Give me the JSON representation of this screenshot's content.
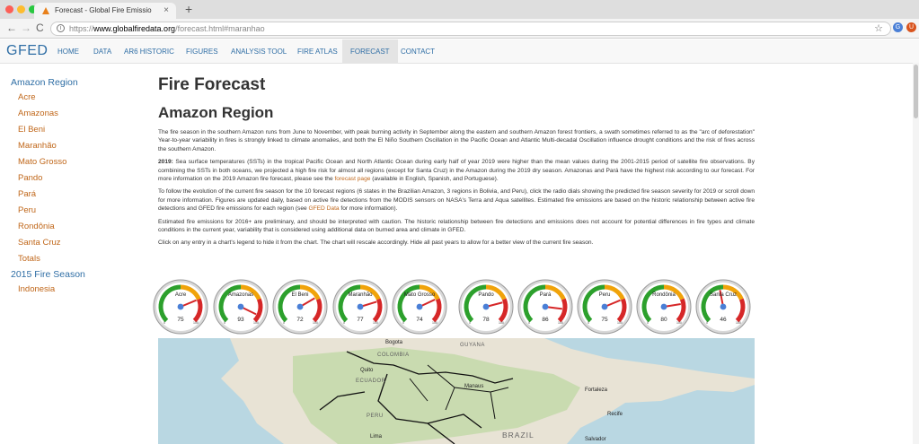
{
  "browser": {
    "tab_title": "Forecast - Global Fire Emissio",
    "url_scheme": "https://",
    "url_host": "www.globalfiredata.org",
    "url_path": "/forecast.html#maranhao",
    "ext1_label": "G",
    "ext2_label": "U"
  },
  "nav": {
    "brand": "GFED",
    "links": [
      "HOME",
      "DATA",
      "AR6 HISTORIC",
      "FIGURES",
      "ANALYSIS TOOL",
      "FIRE ATLAS",
      "FORECAST",
      "CONTACT"
    ],
    "active": "FORECAST"
  },
  "sidebar": {
    "section1": "Amazon Region",
    "items": [
      "Acre",
      "Amazonas",
      "El Beni",
      "Maranhão",
      "Mato Grosso",
      "Pando",
      "Pará",
      "Peru",
      "Rondônia",
      "Santa Cruz",
      "Totals"
    ],
    "section2": "2015 Fire Season",
    "items2": [
      "Indonesia"
    ]
  },
  "content": {
    "title": "Fire Forecast",
    "subtitle": "Amazon Region",
    "p1": "The fire season in the southern Amazon runs from June to November, with peak burning activity in September along the eastern and southern Amazon forest frontiers, a swath sometimes referred to as the \"arc of deforestation\" Year-to-year variability in fires is strongly linked to climate anomalies, and both the El Niño Southern Oscillation in the Pacific Ocean and Atlantic Multi-decadal Oscillation influence drought conditions and the risk of fires across the southern Amazon.",
    "p2_bold": "2019:",
    "p2_text": " Sea surface temperatures (SSTs) in the tropical Pacific Ocean and North Atlantic Ocean during early half of year 2019 were higher than the mean values during the 2001-2015 period of satellite fire observations. By combining the SSTs in both oceans, we projected a high fire risk for almost all regions (except for Santa Cruz) in the Amazon during the 2019 dry season. Amazonas and Pará have the highest risk according to our forecast. For more information on the 2019 Amazon fire forecast, please see the ",
    "p2_link": "forecast page",
    "p2_tail": " (available in English, Spanish, and Portuguese).",
    "p3_text": "To follow the evolution of the current fire season for the 10 forecast regions (6 states in the Brazilian Amazon, 3 regions in Bolivia, and Peru), click the radio dials showing the predicted fire season severity for 2019 or scroll down for more information. Figures are updated daily, based on active fire detections from the MODIS sensors on NASA's Terra and Aqua satellites. Estimated fire emissions are based on the historic relationship between active fire detections and GFED fire emissions for each region (see ",
    "p3_link": "GFED Data",
    "p3_tail": " for more information).",
    "p4": "Estimated fire emissions for 2016+ are preliminary, and should be interpreted with caution. The historic relationship between fire detections and emissions does not account for potential differences in fire types and climate conditions in the current year, variability that is considered using additional data on burned area and climate in GFED.",
    "p5": "Click on any entry in a chart's legend to hide it from the chart. The chart will rescale accordingly. Hide all past years to allow for a better view of the current fire season."
  },
  "gauges": {
    "scale_min": "0",
    "scale_max": "100",
    "items": [
      {
        "label": "Acre",
        "value": 75
      },
      {
        "label": "Amazonas",
        "value": 93
      },
      {
        "label": "El Beni",
        "value": 72
      },
      {
        "label": "Maranhão",
        "value": 77
      },
      {
        "label": "Mato Grosso",
        "value": 74
      },
      {
        "label": "Pando",
        "value": 78
      },
      {
        "label": "Pará",
        "value": 86
      },
      {
        "label": "Peru",
        "value": 75
      },
      {
        "label": "Rondônia",
        "value": 80
      },
      {
        "label": "Santa Cruz",
        "value": 46
      }
    ],
    "colors": {
      "low": "#2ca02c",
      "mid": "#f0a30a",
      "high": "#d62728",
      "needle": "#d62728"
    }
  },
  "map": {
    "countries": [
      "COLOMBIA",
      "GUYANA",
      "ECUADOR",
      "PERU"
    ],
    "big_label": "BRAZIL",
    "cities": [
      "Bogota",
      "Quito",
      "Manaus",
      "Fortaleza",
      "Recife",
      "Lima",
      "Salvador"
    ]
  }
}
